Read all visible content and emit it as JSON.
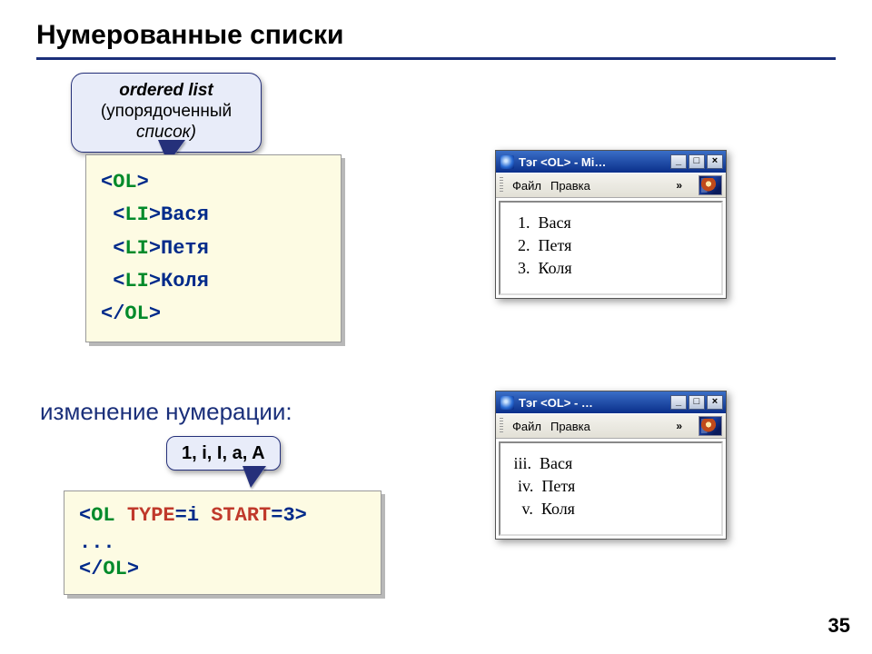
{
  "title": "Нумерованные списки",
  "callout1": {
    "line1": "ordered list",
    "line2": "(упорядоченный",
    "line3": "список)"
  },
  "code1": {
    "l1a": "<",
    "l1b": "OL",
    "l1c": ">",
    "l2a": " <",
    "l2b": "LI",
    "l2c": ">Вася",
    "l3a": " <",
    "l3b": "LI",
    "l3c": ">Петя",
    "l4a": " <",
    "l4b": "LI",
    "l4c": ">Коля",
    "l5a": "</",
    "l5b": "OL",
    "l5c": ">"
  },
  "subhead": "изменение нумерации:",
  "callout2": "1, i, I, a, A",
  "code2": {
    "l1a": "<",
    "l1b": "OL ",
    "l1c": "TYPE",
    "l1d": "=i ",
    "l1e": "START",
    "l1f": "=3>",
    "l2": "...",
    "l3a": "</",
    "l3b": "OL",
    "l3c": ">"
  },
  "win1": {
    "title": "Тэг <OL> - Mi…",
    "menu1": "Файл",
    "menu2": "Правка",
    "chev": "»",
    "rows": [
      "  1.  Вася",
      "  2.  Петя",
      "  3.  Коля"
    ]
  },
  "win2": {
    "title": "Тэг <OL> - …",
    "menu1": "Файл",
    "menu2": "Правка",
    "chev": "»",
    "rows": [
      " iii.  Вася",
      "  iv.  Петя",
      "   v.  Коля"
    ]
  },
  "winbtns": {
    "min": "_",
    "max": "□",
    "close": "×"
  },
  "pagenum": "35"
}
